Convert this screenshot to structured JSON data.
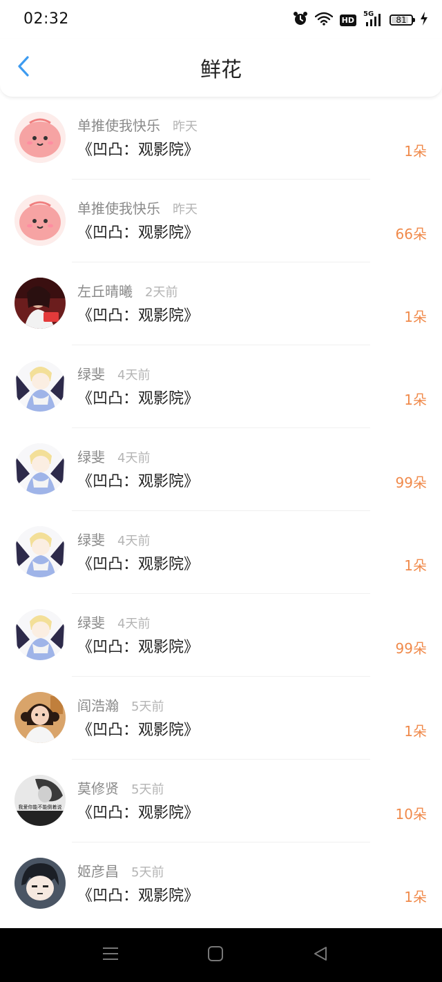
{
  "status_bar": {
    "time": "02:32",
    "network": "5G",
    "hd_label": "HD",
    "battery": "81",
    "icons": [
      "alarm-icon",
      "wifi-icon",
      "signal-icon",
      "battery-icon",
      "charging-icon"
    ]
  },
  "header": {
    "back_icon": "chevron-left-icon",
    "title": "鲜花"
  },
  "colors": {
    "accent_blue": "#3d9bf0",
    "count_orange": "#f08a4b",
    "username_gray": "#8a8a8a",
    "time_gray": "#b4b4b4"
  },
  "flowers": [
    {
      "user": "单推使我快乐",
      "time": "昨天",
      "work": "《凹凸：观影院》",
      "count": "1朵",
      "avatar": "pink-blob-avatar"
    },
    {
      "user": "单推使我快乐",
      "time": "昨天",
      "work": "《凹凸：观影院》",
      "count": "66朵",
      "avatar": "pink-blob-avatar"
    },
    {
      "user": "左丘晴曦",
      "time": "2天前",
      "work": "《凹凸：观影院》",
      "count": "1朵",
      "avatar": "photo-avatar"
    },
    {
      "user": "绿斐",
      "time": "4天前",
      "work": "《凹凸：观影院》",
      "count": "1朵",
      "avatar": "anime-avatar"
    },
    {
      "user": "绿斐",
      "time": "4天前",
      "work": "《凹凸：观影院》",
      "count": "99朵",
      "avatar": "anime-avatar"
    },
    {
      "user": "绿斐",
      "time": "4天前",
      "work": "《凹凸：观影院》",
      "count": "1朵",
      "avatar": "anime-avatar"
    },
    {
      "user": "绿斐",
      "time": "4天前",
      "work": "《凹凸：观影院》",
      "count": "99朵",
      "avatar": "anime-avatar"
    },
    {
      "user": "阎浩瀚",
      "time": "5天前",
      "work": "《凹凸：观影院》",
      "count": "1朵",
      "avatar": "girl-photo-avatar"
    },
    {
      "user": "莫修贤",
      "time": "5天前",
      "work": "《凹凸：观影院》",
      "count": "10朵",
      "avatar": "bw-photo-avatar",
      "avatar_caption": "我爱你能不能倒着说"
    },
    {
      "user": "姬彦昌",
      "time": "5天前",
      "work": "《凹凸：观影院》",
      "count": "1朵",
      "avatar": "anime-boy-avatar"
    }
  ],
  "nav_bar": {
    "icons": [
      "menu-icon",
      "home-icon",
      "back-triangle-icon"
    ]
  }
}
